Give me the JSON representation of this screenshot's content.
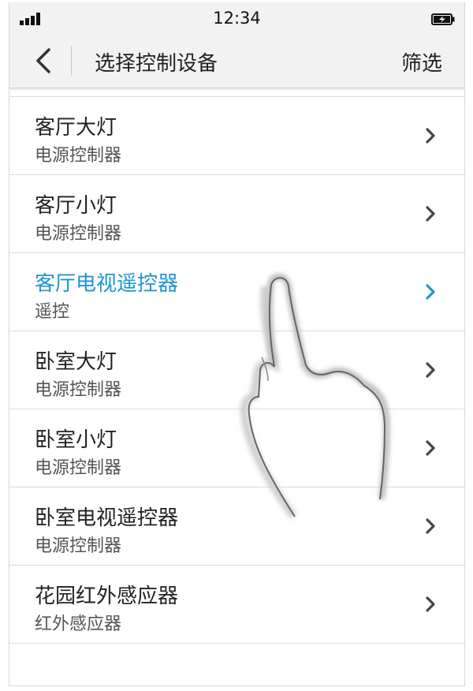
{
  "status_bar": {
    "time": "12:34",
    "signal_icon": "signal-bars-icon",
    "battery_icon": "battery-charging-icon"
  },
  "nav": {
    "back_icon": "chevron-left-icon",
    "title": "选择控制设备",
    "filter_label": "筛选"
  },
  "colors": {
    "accent": "#1f95d2",
    "text": "#222222",
    "subtext": "#555555",
    "divider": "#dcdcdc",
    "bar_background": "#f2f2f2"
  },
  "devices": [
    {
      "name": "客厅大灯",
      "type": "电源控制器",
      "active": false
    },
    {
      "name": "客厅小灯",
      "type": "电源控制器",
      "active": false
    },
    {
      "name": "客厅电视遥控器",
      "type": "遥控",
      "active": true
    },
    {
      "name": "卧室大灯",
      "type": "电源控制器",
      "active": false
    },
    {
      "name": "卧室小灯",
      "type": "电源控制器",
      "active": false
    },
    {
      "name": "卧室电视遥控器",
      "type": "电源控制器",
      "active": false
    },
    {
      "name": "花园红外感应器",
      "type": "红外感应器",
      "active": false
    }
  ],
  "overlay": {
    "icon": "tap-hand-icon"
  }
}
